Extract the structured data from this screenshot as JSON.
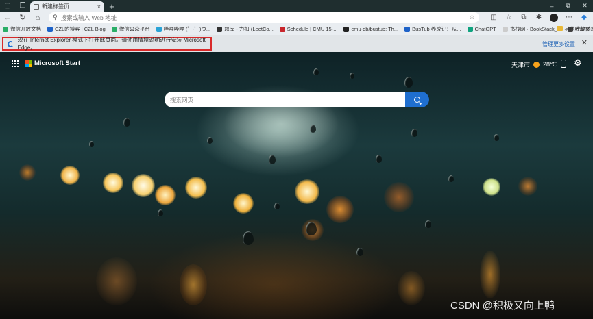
{
  "window": {
    "tab_title": "新建标签页",
    "minimize": "–",
    "maximize": "⧉",
    "close": "✕"
  },
  "toolbar": {
    "back": "←",
    "refresh": "↻",
    "home": "⌂",
    "address_placeholder": "搜索或输入 Web 地址"
  },
  "bookmarks": {
    "items": [
      {
        "label": "微信开放文档",
        "color": "#2aae67"
      },
      {
        "label": "CZL的博客 | CZL Blog",
        "color": "#1e62c8"
      },
      {
        "label": "微信公众平台",
        "color": "#2aae67"
      },
      {
        "label": "哔哩哔哩 (゜-゜)つ...",
        "color": "#29a3d6"
      },
      {
        "label": "题库 - 力扣 (LeetCo...",
        "color": "#333333"
      },
      {
        "label": "Schedule | CMU 15-...",
        "color": "#c8262c"
      },
      {
        "label": "cmu-db/bustub: Th...",
        "color": "#222222"
      },
      {
        "label": "BusTub 养成记：从...",
        "color": "#1e62c8"
      },
      {
        "label": "ChatGPT",
        "color": "#10a37f"
      },
      {
        "label": "书栈网 · BookStack_...",
        "color": "#cccccc"
      },
      {
        "label": "代码随想录",
        "color": "#444444"
      }
    ],
    "more": "›",
    "other_folder": "其他收藏夹"
  },
  "infobar": {
    "message": "现在 Internet Explorer 模式下打开此页面。请使用情境说明进行安装 Microsoft Edge。",
    "manage_link": "管理更多设置",
    "close": "✕"
  },
  "start": {
    "brand": "Microsoft Start",
    "city": "天津市",
    "temperature": "28℃",
    "search_placeholder": "搜索网页"
  },
  "watermark": "CSDN @积极又向上鸭",
  "colors": {
    "accent": "#1f6fd0",
    "highlight_border": "#d82a2a",
    "titlebar": "#1f2e2f"
  }
}
